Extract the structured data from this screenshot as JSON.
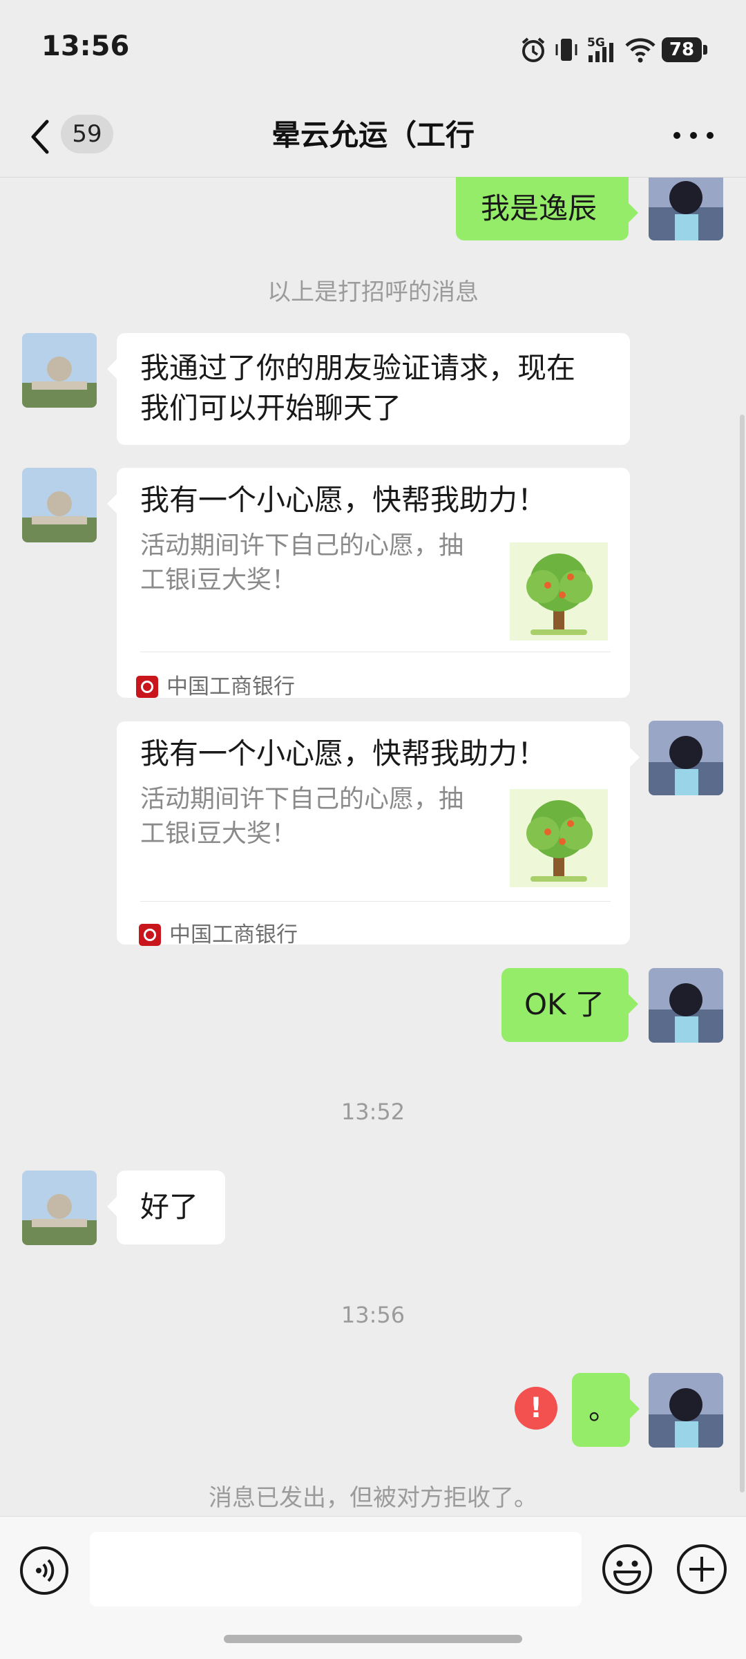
{
  "status_bar": {
    "time": "13:56",
    "network": "5G",
    "battery": "78"
  },
  "header": {
    "unread_count": "59",
    "title": "晕云允运（工行"
  },
  "messages": {
    "m1_text": "我是逸辰",
    "greeting_notice": "以上是打招呼的消息",
    "m2_line1": "我通过了你的朋友验证请求，现在",
    "m2_line2": "我们可以开始聊天了",
    "card1": {
      "title": "我有一个小心愿，快帮我助力！",
      "desc_line1": "活动期间许下自己的心愿，抽",
      "desc_line2": "工银i豆大奖！",
      "source": "中国工商银行"
    },
    "card2": {
      "title": "我有一个小心愿，快帮我助力！",
      "desc_line1": "活动期间许下自己的心愿，抽",
      "desc_line2": "工银i豆大奖！",
      "source": "中国工商银行"
    },
    "m5_text": "OK 了",
    "time1": "13:52",
    "m6_text": "好了",
    "time2": "13:56",
    "m7_text": "。",
    "fail_mark": "!",
    "rejected_notice": "消息已发出，但被对方拒收了。"
  },
  "input_bar": {
    "placeholder": ""
  },
  "icons": [
    "back-arrow-icon",
    "more-icon",
    "voice-icon",
    "emoji-icon",
    "plus-icon",
    "alarm-icon",
    "vibrate-icon",
    "signal-icon",
    "wifi-icon",
    "battery-icon",
    "tree-thumbnail-icon",
    "icbc-logo-icon",
    "send-failed-icon"
  ],
  "colors": {
    "background": "#ededed",
    "sent_bubble": "#95ec69",
    "received_bubble": "#ffffff",
    "error": "#f2514f",
    "system_text": "#9b9b9b"
  }
}
